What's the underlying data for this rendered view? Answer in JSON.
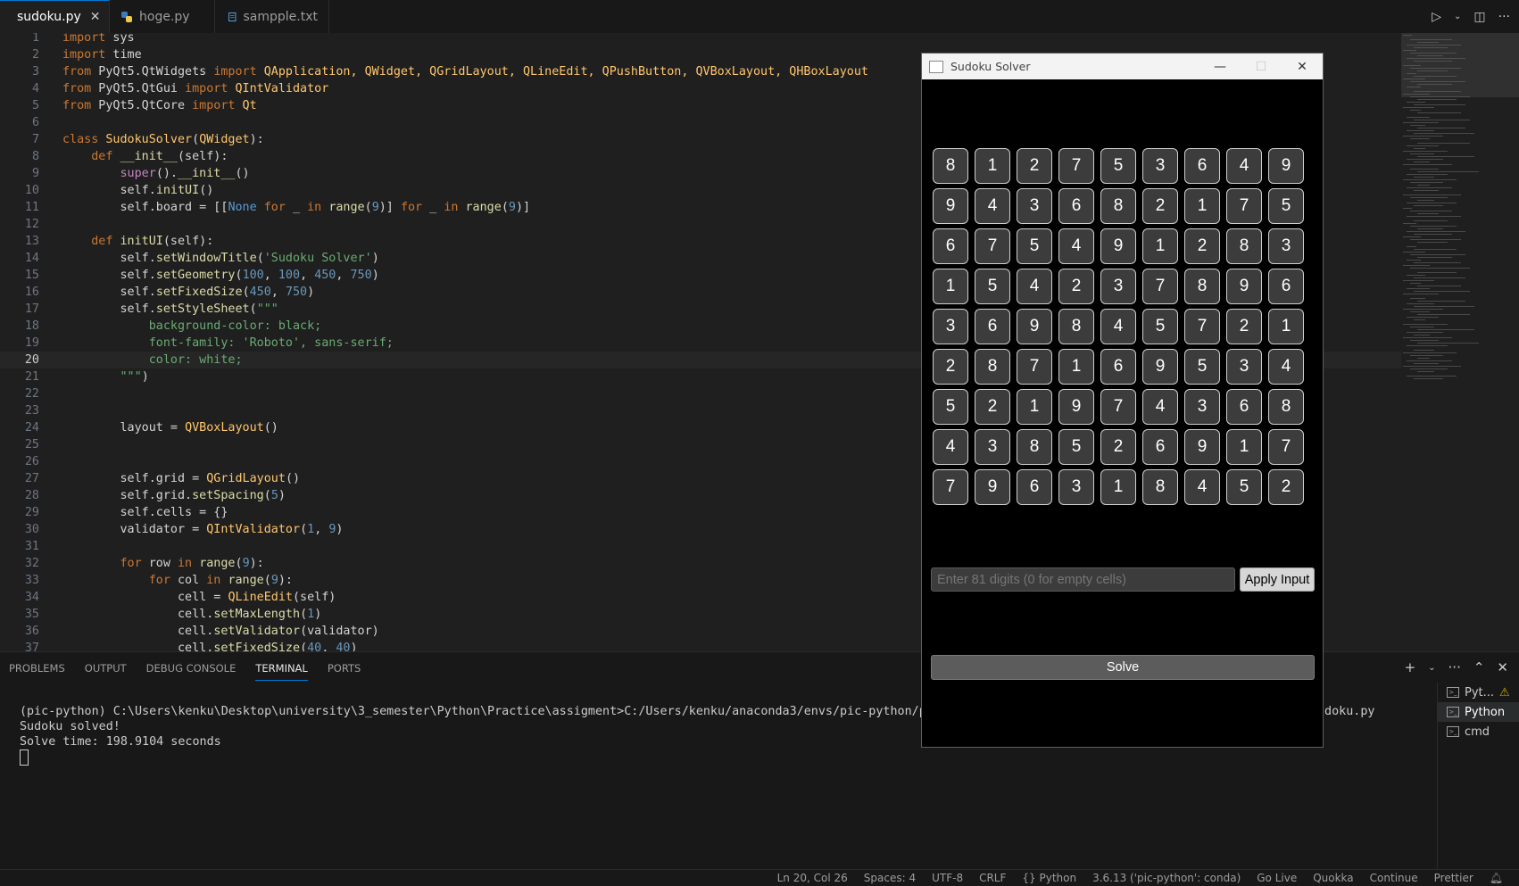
{
  "tabs": [
    {
      "label": "sudoku.py",
      "active": true,
      "icon": "python-file-icon"
    },
    {
      "label": "hoge.py",
      "active": false,
      "icon": "python-file-icon"
    },
    {
      "label": "sampple.txt",
      "active": false,
      "icon": "text-file-icon"
    }
  ],
  "editor": {
    "current_line": 20,
    "lines": [
      {
        "n": "1"
      },
      {
        "n": "2"
      },
      {
        "n": "3"
      },
      {
        "n": "4"
      },
      {
        "n": "5"
      },
      {
        "n": "6"
      },
      {
        "n": "7"
      },
      {
        "n": "8"
      },
      {
        "n": "9"
      },
      {
        "n": "10"
      },
      {
        "n": "11"
      },
      {
        "n": "12"
      },
      {
        "n": "13"
      },
      {
        "n": "14"
      },
      {
        "n": "15"
      },
      {
        "n": "16"
      },
      {
        "n": "17"
      },
      {
        "n": "18"
      },
      {
        "n": "19"
      },
      {
        "n": "20"
      },
      {
        "n": "21"
      },
      {
        "n": "22"
      },
      {
        "n": "23"
      },
      {
        "n": "24"
      },
      {
        "n": "25"
      },
      {
        "n": "26"
      },
      {
        "n": "27"
      },
      {
        "n": "28"
      },
      {
        "n": "29"
      },
      {
        "n": "30"
      },
      {
        "n": "31"
      },
      {
        "n": "32"
      },
      {
        "n": "33"
      },
      {
        "n": "34"
      },
      {
        "n": "35"
      },
      {
        "n": "36"
      },
      {
        "n": "37"
      }
    ]
  },
  "code": {
    "l1": [
      "import",
      " sys"
    ],
    "l2": [
      "import",
      " time"
    ],
    "l3": [
      "from",
      " PyQt5.QtWidgets ",
      "import",
      " QApplication, QWidget, QGridLayout, QLineEdit, QPushButton, QVBoxLayout, QHBoxLayout"
    ],
    "l4": [
      "from",
      " PyQt5.QtGui ",
      "import",
      " QIntValidator"
    ],
    "l5": [
      "from",
      " PyQt5.QtCore ",
      "import",
      " Qt"
    ],
    "l7": [
      "class",
      " ",
      "SudokuSolver",
      "(",
      "QWidget",
      "):"
    ],
    "l8": [
      "    ",
      "def",
      " ",
      "__init__",
      "(self):"
    ],
    "l9": [
      "        ",
      "super",
      "().",
      "__init__",
      "()"
    ],
    "l10": [
      "        self.",
      "initUI",
      "()"
    ],
    "l11": [
      "        self.board = [[",
      "None",
      " ",
      "for",
      " _ ",
      "in",
      " ",
      "range",
      "(",
      "9",
      ")] ",
      "for",
      " _ ",
      "in",
      " ",
      "range",
      "(",
      "9",
      ")]"
    ],
    "l13": [
      "    ",
      "def",
      " ",
      "initUI",
      "(self):"
    ],
    "l14": [
      "        self.",
      "setWindowTitle",
      "(",
      "'Sudoku Solver'",
      ")"
    ],
    "l15": [
      "        self.",
      "setGeometry",
      "(",
      "100",
      ", ",
      "100",
      ", ",
      "450",
      ", ",
      "750",
      ")"
    ],
    "l16": [
      "        self.",
      "setFixedSize",
      "(",
      "450",
      ", ",
      "750",
      ")"
    ],
    "l17": [
      "        self.",
      "setStyleSheet",
      "(",
      "\"\"\""
    ],
    "l18": [
      "            background-color: black;"
    ],
    "l19": [
      "            font-family: 'Roboto', sans-serif;"
    ],
    "l20": [
      "            color: white;"
    ],
    "l21": [
      "        \"\"\"",
      ")"
    ],
    "l24": [
      "        layout = ",
      "QVBoxLayout",
      "()"
    ],
    "l27": [
      "        self.grid = ",
      "QGridLayout",
      "()"
    ],
    "l28": [
      "        self.grid.",
      "setSpacing",
      "(",
      "5",
      ")"
    ],
    "l29": [
      "        self.cells = {}"
    ],
    "l30": [
      "        validator = ",
      "QIntValidator",
      "(",
      "1",
      ", ",
      "9",
      ")"
    ],
    "l32": [
      "        ",
      "for",
      " row ",
      "in",
      " ",
      "range",
      "(",
      "9",
      "):"
    ],
    "l33": [
      "            ",
      "for",
      " col ",
      "in",
      " ",
      "range",
      "(",
      "9",
      "):"
    ],
    "l34": [
      "                cell = ",
      "QLineEdit",
      "(self)"
    ],
    "l35": [
      "                cell.",
      "setMaxLength",
      "(",
      "1",
      ")"
    ],
    "l36": [
      "                cell.",
      "setValidator",
      "(validator)"
    ],
    "l37": [
      "                cell.",
      "setFixedSize",
      "(",
      "40",
      ", ",
      "40",
      ")"
    ]
  },
  "panel": {
    "tabs": [
      "PROBLEMS",
      "OUTPUT",
      "DEBUG CONSOLE",
      "TERMINAL",
      "PORTS"
    ],
    "active_tab": "TERMINAL",
    "terminal_lines": [
      "(pic-python) C:\\Users\\kenku\\Desktop\\university\\3_semester\\Python\\Practice\\assigment>C:/Users/kenku/anaconda3/envs/pic-python/python.exe c:/Users",
      "Sudoku solved!",
      "Solve time: 198.9104 seconds"
    ],
    "terminal_line1_tail": "udoku.py",
    "terminal_sessions": [
      {
        "label": "Pyt...",
        "warning": true
      },
      {
        "label": "Python",
        "selected": true
      },
      {
        "label": "cmd"
      }
    ]
  },
  "statusbar": {
    "items": [
      "Ln 20, Col 26",
      "Spaces: 4",
      "UTF-8",
      "CRLF",
      "{} Python",
      "3.6.13 ('pic-python': conda)",
      "Go Live",
      "Quokka",
      "Continue",
      "Prettier"
    ]
  },
  "sudoku_window": {
    "title": "Sudoku Solver",
    "minimize": "—",
    "maximize": "☐",
    "close": "✕",
    "grid": [
      [
        "8",
        "1",
        "2",
        "7",
        "5",
        "3",
        "6",
        "4",
        "9"
      ],
      [
        "9",
        "4",
        "3",
        "6",
        "8",
        "2",
        "1",
        "7",
        "5"
      ],
      [
        "6",
        "7",
        "5",
        "4",
        "9",
        "1",
        "2",
        "8",
        "3"
      ],
      [
        "1",
        "5",
        "4",
        "2",
        "3",
        "7",
        "8",
        "9",
        "6"
      ],
      [
        "3",
        "6",
        "9",
        "8",
        "4",
        "5",
        "7",
        "2",
        "1"
      ],
      [
        "2",
        "8",
        "7",
        "1",
        "6",
        "9",
        "5",
        "3",
        "4"
      ],
      [
        "5",
        "2",
        "1",
        "9",
        "7",
        "4",
        "3",
        "6",
        "8"
      ],
      [
        "4",
        "3",
        "8",
        "5",
        "2",
        "6",
        "9",
        "1",
        "7"
      ],
      [
        "7",
        "9",
        "6",
        "3",
        "1",
        "8",
        "4",
        "5",
        "2"
      ]
    ],
    "input_placeholder": "Enter 81 digits (0 for empty cells)",
    "apply_label": "Apply Input",
    "solve_label": "Solve"
  }
}
